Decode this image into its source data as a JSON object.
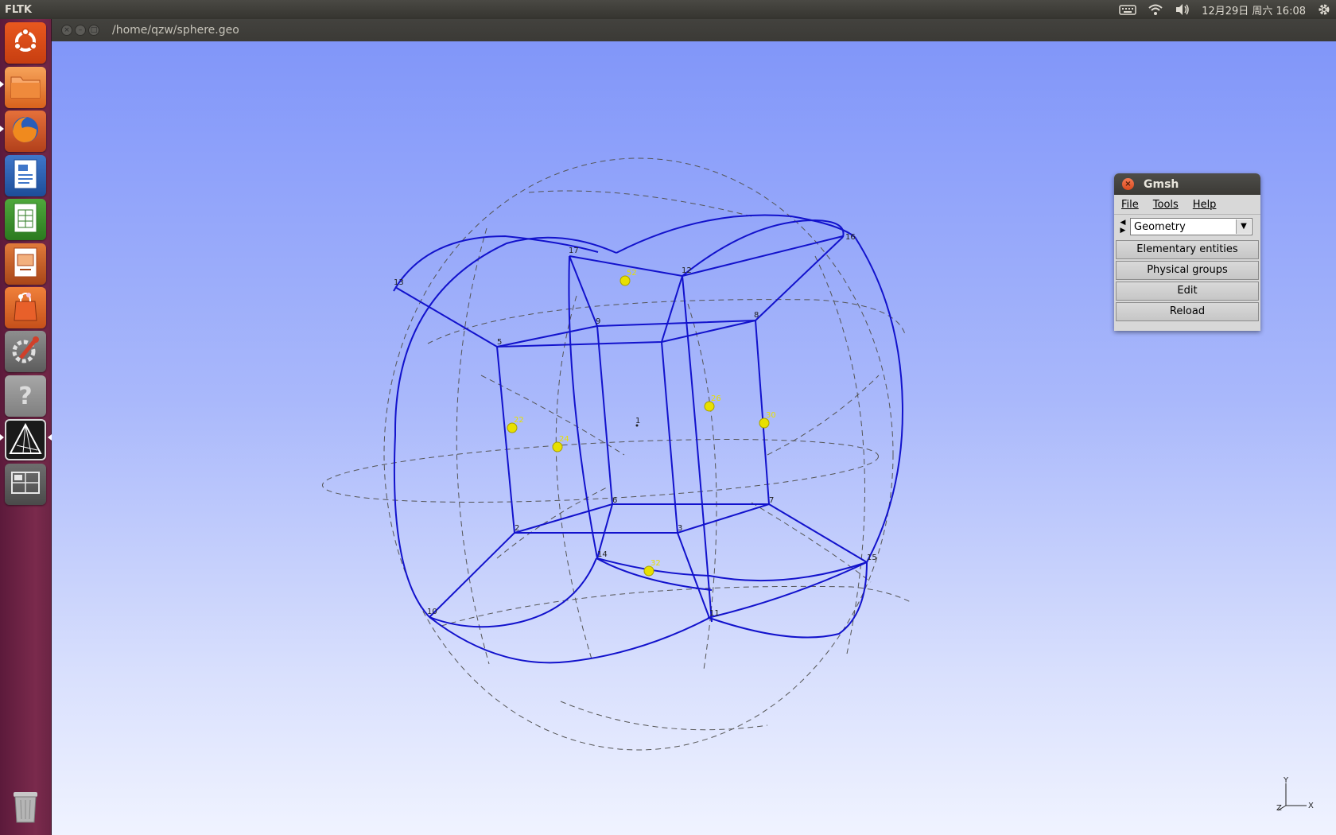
{
  "top_panel": {
    "app_name": "FLTK",
    "clock": "12月29日 周六 16:08",
    "indicators": [
      "keyboard-icon",
      "wifi-icon",
      "volume-icon",
      "settings-gear-icon"
    ]
  },
  "launcher": {
    "items": [
      {
        "name": "ubuntu-dash",
        "icon": "ubuntu-logo-icon"
      },
      {
        "name": "files",
        "icon": "folder-icon"
      },
      {
        "name": "firefox",
        "icon": "firefox-icon"
      },
      {
        "name": "libreoffice-writer",
        "icon": "writer-icon"
      },
      {
        "name": "libreoffice-calc",
        "icon": "calc-icon"
      },
      {
        "name": "libreoffice-impress",
        "icon": "impress-icon"
      },
      {
        "name": "software-center",
        "icon": "shopping-bag-icon"
      },
      {
        "name": "system-settings",
        "icon": "wrench-icon"
      },
      {
        "name": "help",
        "icon": "question-icon"
      },
      {
        "name": "gmsh",
        "icon": "gmsh-icon"
      },
      {
        "name": "workspace-switcher",
        "icon": "workspace-icon"
      },
      {
        "name": "trash",
        "icon": "trash-icon"
      }
    ]
  },
  "window": {
    "path": "/home/qzw/sphere.geo"
  },
  "gmsh_panel": {
    "title": "Gmsh",
    "menu": [
      "File",
      "Tools",
      "Help"
    ],
    "module": "Geometry",
    "buttons": [
      "Elementary entities",
      "Physical groups",
      "Edit",
      "Reload"
    ]
  },
  "geometry": {
    "point_labels": [
      "1",
      "2",
      "3",
      "5",
      "6",
      "7",
      "8",
      "9",
      "10",
      "11",
      "12",
      "13",
      "14",
      "15",
      "16",
      "17"
    ],
    "center_label": "1",
    "surface_markers": [
      "52",
      "24",
      "22",
      "26",
      "32",
      "30"
    ],
    "colors": {
      "edges": "#1010cc",
      "dashed": "#555555",
      "markers": "#e8e000",
      "labels": "#222222"
    }
  },
  "axis": {
    "y": "Y",
    "x": "X",
    "z": "Z"
  }
}
